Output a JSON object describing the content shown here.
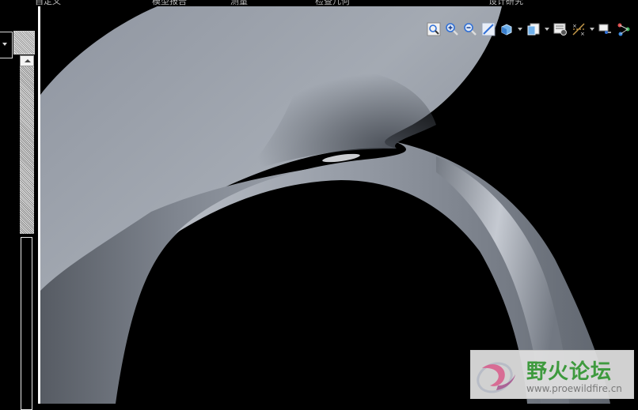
{
  "menu": {
    "tabs": [
      {
        "label": "自定义"
      },
      {
        "label": "模型报告"
      },
      {
        "label": "测量"
      },
      {
        "label": "检查几何"
      },
      {
        "label": "设计研究"
      }
    ]
  },
  "toolbar": {
    "icons": [
      "zoom-fit-icon",
      "zoom-in-icon",
      "zoom-out-icon",
      "repaint-icon",
      "shading-style-icon",
      "saved-views-icon",
      "view-manager-icon",
      "datum-display-icon",
      "spin-center-icon",
      "annotation-display-icon"
    ]
  },
  "watermark": {
    "title": "野火论坛",
    "url": "www.proewildfire.cn"
  },
  "colors": {
    "background": "#000000",
    "model_surface": "#9ba1ab",
    "toolbar_accent": "#2f6fd6",
    "watermark_green": "#3e9a3e"
  }
}
